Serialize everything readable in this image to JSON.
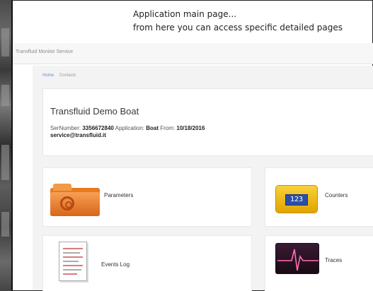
{
  "callout": {
    "line1": "Application main page...",
    "line2": "from here you can access specific detailed pages"
  },
  "app": {
    "title": "Transfluid Monitor Service"
  },
  "breadcrumb": {
    "home": "Home",
    "current": "Contacts"
  },
  "boat": {
    "name": "Transfluid Demo Boat",
    "serial_label": "SerNumber:",
    "serial_value": "3356672840",
    "application_label": "Application:",
    "application_value": "Boat",
    "from_label": "From:",
    "from_value": "10/18/2016",
    "email": "service@transfluid.it"
  },
  "tiles": {
    "parameters": "Parameters",
    "counters": "Counters",
    "counters_screen": "123",
    "events_log": "Events Log",
    "traces": "Traces"
  },
  "icons": {
    "parameters": "folder-gear-icon",
    "counters": "counter-icon",
    "events_log": "document-icon",
    "traces": "oscilloscope-icon"
  },
  "colors": {
    "folder": "#e87a1e",
    "counter": "#f2c21a",
    "counter_screen": "#2b4fa8",
    "trace_bg": "#2a1226",
    "trace_line": "#ff6fb5"
  }
}
